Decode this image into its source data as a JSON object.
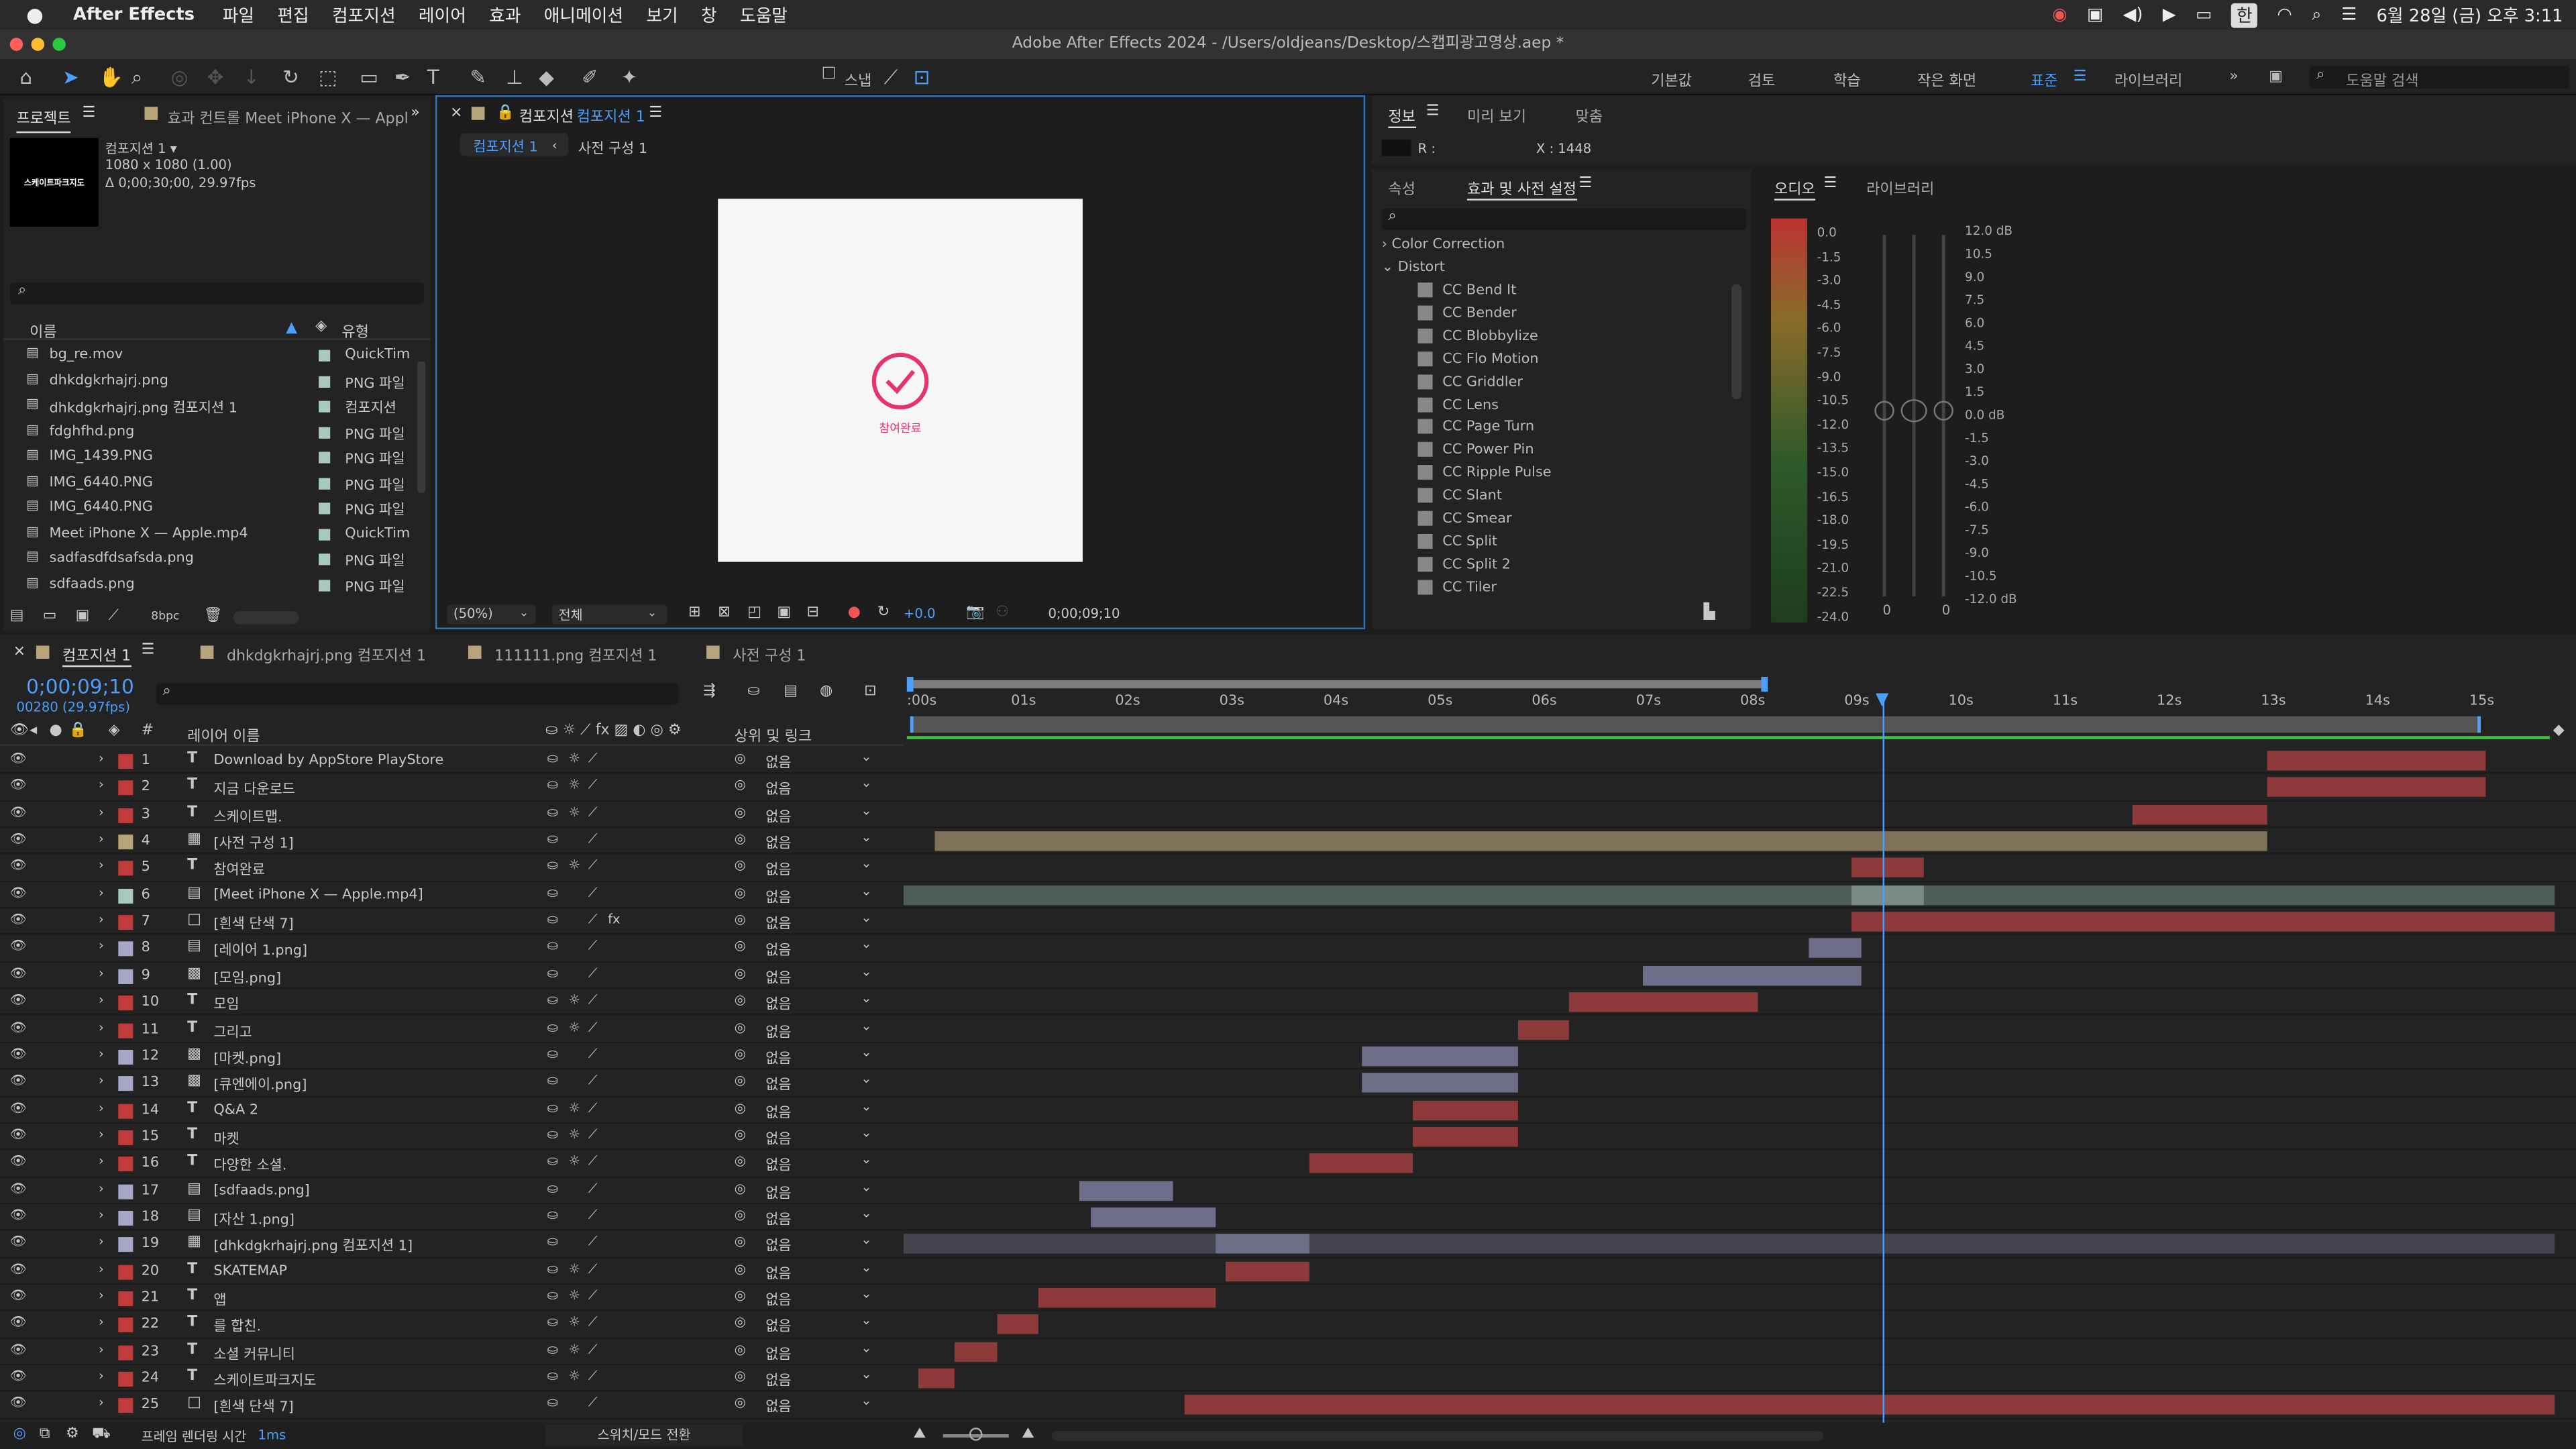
{
  "menubar": {
    "app": "After Effects",
    "items": [
      "파일",
      "편집",
      "컴포지션",
      "레이어",
      "효과",
      "애니메이션",
      "보기",
      "창",
      "도움말"
    ],
    "ime": "한",
    "datetime": "6월 28일 (금) 오후 3:11"
  },
  "window_title": "Adobe After Effects 2024 - /Users/oldjeans/Desktop/스캡피광고영상.aep *",
  "toolbar": {
    "snap_label": "스냅",
    "workspaces": [
      "기본값",
      "검토",
      "학습",
      "작은 화면",
      "표준",
      "라이브러리"
    ],
    "search_placeholder": "도움말 검색"
  },
  "project": {
    "tab": "프로젝트",
    "effect_controls_tab": "효과 컨트롤 Meet iPhone X — Appl",
    "thumb_text": "스케이트파크지도",
    "comp_name": "컴포지션 1 ▾",
    "comp_size": "1080 x 1080 (1.00)",
    "comp_duration": "Δ 0;00;30;00, 29.97fps",
    "col_name": "이름",
    "col_type": "유형",
    "bpc": "8bpc",
    "items": [
      {
        "name": "bg_re.mov",
        "type": "QuickTim"
      },
      {
        "name": "dhkdgkrhajrj.png",
        "type": "PNG 파일"
      },
      {
        "name": "dhkdgkrhajrj.png 컴포지션 1",
        "type": "컴포지션"
      },
      {
        "name": "fdghfhd.png",
        "type": "PNG 파일"
      },
      {
        "name": "IMG_1439.PNG",
        "type": "PNG 파일"
      },
      {
        "name": "IMG_6440.PNG",
        "type": "PNG 파일"
      },
      {
        "name": "IMG_6440.PNG",
        "type": "PNG 파일"
      },
      {
        "name": "Meet iPhone X — Apple.mp4",
        "type": "QuickTim"
      },
      {
        "name": "sadfasdfdsafsda.png",
        "type": "PNG 파일"
      },
      {
        "name": "sdfaads.png",
        "type": "PNG 파일"
      }
    ]
  },
  "composition": {
    "tab_prefix": "컴포지션",
    "tab_name": "컴포지션 1",
    "sub_tab1": "컴포지션 1",
    "sub_tab2": "사전 구성 1",
    "preview_text": "참여완료",
    "zoom": "(50%)",
    "resolution": "전체",
    "exposure": "+0.0",
    "timecode": "0;00;09;10"
  },
  "info": {
    "tab": "정보",
    "preview_tab": "미리 보기",
    "fit_tab": "맞춤",
    "r_label": "R :",
    "x_label": "X : 1448"
  },
  "effects": {
    "props_tab": "속성",
    "tab": "효과 및 사전 설정",
    "categories": [
      "Color Correction",
      "Distort"
    ],
    "items": [
      "CC Bend It",
      "CC Bender",
      "CC Blobbylize",
      "CC Flo Motion",
      "CC Griddler",
      "CC Lens",
      "CC Page Turn",
      "CC Power Pin",
      "CC Ripple Pulse",
      "CC Slant",
      "CC Smear",
      "CC Split",
      "CC Split 2",
      "CC Tiler"
    ]
  },
  "audio": {
    "tab": "오디오",
    "library_tab": "라이브러리",
    "left_scale": [
      "0.0",
      "-1.5",
      "-3.0",
      "-4.5",
      "-6.0",
      "-7.5",
      "-9.0",
      "-10.5",
      "-12.0",
      "-13.5",
      "-15.0",
      "-16.5",
      "-18.0",
      "-19.5",
      "-21.0",
      "-22.5",
      "-24.0"
    ],
    "right_scale": [
      "12.0 dB",
      "10.5",
      "9.0",
      "7.5",
      "6.0",
      "4.5",
      "3.0",
      "1.5",
      "0.0 dB",
      "-1.5",
      "-3.0",
      "-4.5",
      "-6.0",
      "-7.5",
      "-9.0",
      "-10.5",
      "-12.0 dB"
    ],
    "zero_left": "0",
    "zero_right": "0"
  },
  "timeline": {
    "tabs": [
      "컴포지션 1",
      "dhkdgkrhajrj.png 컴포지션 1",
      "111111.png 컴포지션 1",
      "사전 구성 1"
    ],
    "timecode": "0;00;09;10",
    "frame_info": "00280 (29.97fps)",
    "col_layer": "레이어 이름",
    "col_parent": "상위 및 링크",
    "ruler": [
      ":00s",
      "01s",
      "02s",
      "03s",
      "04s",
      "05s",
      "06s",
      "07s",
      "08s",
      "09s",
      "10s",
      "11s",
      "12s",
      "13s",
      "14s",
      "15s"
    ],
    "footer_render": "프레임 렌더링 시간",
    "footer_ms": "1ms",
    "footer_switch": "스위치/모드 전환",
    "playhead_sec": 9.3,
    "layers": [
      {
        "num": "1",
        "name": "Download by AppStore PlayStore",
        "type": "T",
        "color": "#c23b3b",
        "parent": "없음",
        "start": 13.0,
        "end": 15.1,
        "bar": "#8e3a3a"
      },
      {
        "num": "2",
        "name": "지금 다운로드",
        "type": "T",
        "color": "#c23b3b",
        "parent": "없음",
        "start": 13.0,
        "end": 15.1,
        "bar": "#8e3a3a"
      },
      {
        "num": "3",
        "name": "스케이트맵.",
        "type": "T",
        "color": "#c23b3b",
        "parent": "없음",
        "start": 11.7,
        "end": 13.0,
        "bar": "#8e3a3a"
      },
      {
        "num": "4",
        "name": "[사전 구성 1]",
        "type": "C",
        "color": "#b8a47a",
        "parent": "없음",
        "start": 0.2,
        "end": 13.0,
        "bar": "#7f7258",
        "tail": true
      },
      {
        "num": "5",
        "name": "참여완료",
        "type": "T",
        "color": "#c23b3b",
        "parent": "없음",
        "start": 9.0,
        "end": 9.7,
        "bar": "#8e3a3a"
      },
      {
        "num": "6",
        "name": "[Meet iPhone X — Apple.mp4]",
        "type": "F",
        "color": "#a8c8c0",
        "parent": "없음",
        "start": -0.2,
        "end": 15.8,
        "bar": "#4e5d5a",
        "highlight": [
          9.0,
          9.7
        ]
      },
      {
        "num": "7",
        "name": "[흰색 단색 7]",
        "type": "S",
        "color": "#c23b3b",
        "parent": "없음",
        "start": 9.0,
        "end": 15.8,
        "bar": "#8e3a3a",
        "fx": true
      },
      {
        "num": "8",
        "name": "[레이어 1.png]",
        "type": "F",
        "color": "#a6a6c6",
        "parent": "없음",
        "start": 8.6,
        "end": 9.1,
        "bar": "#6e6e8a"
      },
      {
        "num": "9",
        "name": "[모임.png]",
        "type": "I",
        "color": "#a6a6c6",
        "parent": "없음",
        "start": 7.0,
        "end": 9.1,
        "bar": "#6e6e8a"
      },
      {
        "num": "10",
        "name": "모임",
        "type": "T",
        "color": "#c23b3b",
        "parent": "없음",
        "start": 6.3,
        "end": 8.1,
        "bar": "#8e3a3a"
      },
      {
        "num": "11",
        "name": "그리고",
        "type": "T",
        "color": "#c23b3b",
        "parent": "없음",
        "start": 5.8,
        "end": 6.3,
        "bar": "#8e3a3a"
      },
      {
        "num": "12",
        "name": "[마켓.png]",
        "type": "I",
        "color": "#a6a6c6",
        "parent": "없음",
        "start": 4.3,
        "end": 5.8,
        "bar": "#6e6e8a"
      },
      {
        "num": "13",
        "name": "[큐엔에이.png]",
        "type": "I",
        "color": "#a6a6c6",
        "parent": "없음",
        "start": 4.3,
        "end": 5.8,
        "bar": "#6e6e8a"
      },
      {
        "num": "14",
        "name": "Q&A 2",
        "type": "T",
        "color": "#c23b3b",
        "parent": "없음",
        "start": 4.8,
        "end": 5.8,
        "bar": "#8e3a3a"
      },
      {
        "num": "15",
        "name": "마켓",
        "type": "T",
        "color": "#c23b3b",
        "parent": "없음",
        "start": 4.8,
        "end": 5.8,
        "bar": "#8e3a3a"
      },
      {
        "num": "16",
        "name": "다양한 소셜.",
        "type": "T",
        "color": "#c23b3b",
        "parent": "없음",
        "start": 3.8,
        "end": 4.8,
        "bar": "#8e3a3a"
      },
      {
        "num": "17",
        "name": "[sdfaads.png]",
        "type": "F",
        "color": "#a6a6c6",
        "parent": "없음",
        "start": 1.6,
        "end": 2.5,
        "bar": "#6e6e8a"
      },
      {
        "num": "18",
        "name": "[자산 1.png]",
        "type": "F",
        "color": "#a6a6c6",
        "parent": "없음",
        "start": 1.7,
        "end": 2.9,
        "bar": "#6e6e8a"
      },
      {
        "num": "19",
        "name": "[dhkdgkrhajrj.png 컴포지션 1]",
        "type": "C",
        "color": "#a6a6c6",
        "parent": "없음",
        "start": -0.2,
        "end": 15.8,
        "bar": "#44444f",
        "highlight": [
          2.9,
          3.8
        ]
      },
      {
        "num": "20",
        "name": "SKATEMAP",
        "type": "T",
        "color": "#c23b3b",
        "parent": "없음",
        "start": 3.0,
        "end": 3.8,
        "bar": "#8e3a3a"
      },
      {
        "num": "21",
        "name": "앱",
        "type": "T",
        "color": "#c23b3b",
        "parent": "없음",
        "start": 1.2,
        "end": 2.9,
        "bar": "#8e3a3a"
      },
      {
        "num": "22",
        "name": "를 합친.",
        "type": "T",
        "color": "#c23b3b",
        "parent": "없음",
        "start": 0.8,
        "end": 1.2,
        "bar": "#8e3a3a"
      },
      {
        "num": "23",
        "name": "소셜 커뮤니티",
        "type": "T",
        "color": "#c23b3b",
        "parent": "없음",
        "start": 0.4,
        "end": 0.8,
        "bar": "#8e3a3a"
      },
      {
        "num": "24",
        "name": "스케이트파크지도",
        "type": "T",
        "color": "#c23b3b",
        "parent": "없음",
        "start": 0.05,
        "end": 0.4,
        "bar": "#8e3a3a"
      },
      {
        "num": "25",
        "name": "[흰색 단색 7]",
        "type": "S",
        "color": "#c23b3b",
        "parent": "없음",
        "start": 2.6,
        "end": 15.8,
        "bar": "#8e3a3a"
      }
    ]
  }
}
